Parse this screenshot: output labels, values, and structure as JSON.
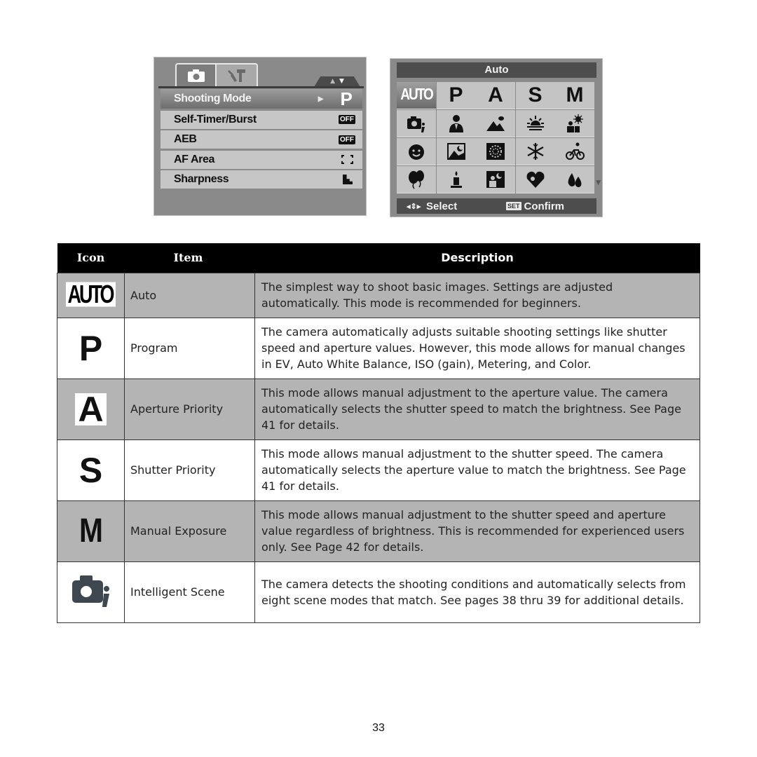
{
  "camera_menu": {
    "tabs": [
      {
        "name": "camera-tab",
        "icon": "camera-icon",
        "active": true
      },
      {
        "name": "setup-tab",
        "icon": "wrench-hammer-icon",
        "active": false
      }
    ],
    "scroll_indicator": {
      "up": "▲",
      "down": "▼"
    },
    "items": [
      {
        "label": "Shooting Mode",
        "value": "P",
        "submenu_arrow": "▶",
        "selected": true
      },
      {
        "label": "Self-Timer/Burst",
        "value": "OFF"
      },
      {
        "label": "AEB",
        "value": "OFF"
      },
      {
        "label": "AF Area",
        "value_icon": "af-area-wide-icon"
      },
      {
        "label": "Sharpness",
        "value_icon": "sharpness-normal-icon"
      }
    ]
  },
  "mode_selector": {
    "title": "Auto",
    "modes_row1": [
      "AUTO",
      "P",
      "A",
      "S",
      "M"
    ],
    "scene_icons": [
      "intelligent-scene-icon",
      "portrait-icon",
      "landscape-icon",
      "sunset-icon",
      "backlight-icon",
      "children-icon",
      "night-scene-icon",
      "fireworks-icon",
      "snow-icon",
      "sports-icon",
      "party-icon",
      "indoor-candle-icon",
      "night-portrait-icon",
      "soft-skin-icon",
      "water-icon"
    ],
    "selected_index": 0,
    "scroll_arrow": "▼",
    "footer": {
      "nav_icon": "◂⇕▸",
      "select_label": "Select",
      "set_badge": "SET",
      "confirm_label": "Confirm"
    }
  },
  "table": {
    "headers": {
      "icon": "Icon",
      "item": "Item",
      "description": "Description"
    },
    "rows": [
      {
        "icon_text": "AUTO",
        "item": "Auto",
        "description": "The simplest way to shoot basic images. Settings are adjusted automatically. This mode is recommended for beginners."
      },
      {
        "icon_text": "P",
        "item": "Program",
        "description": "The camera automatically adjusts suitable shooting settings like shutter speed and aperture values. However, this mode allows for manual changes in EV, Auto White Balance, ISO (gain), Metering, and Color."
      },
      {
        "icon_text": "A",
        "item": "Aperture Priority",
        "description": "This mode allows manual adjustment to the aperture value. The camera automatically selects the shutter speed to match the brightness. See Page 41 for details."
      },
      {
        "icon_text": "S",
        "item": "Shutter Priority",
        "description": "This mode allows manual adjustment to the shutter speed. The camera automatically selects the aperture value to match the brightness. See Page 41 for details."
      },
      {
        "icon_text": "M",
        "item": "Manual Exposure",
        "description": "This mode allows manual adjustment to the shutter speed and aperture value regardless of brightness. This is recommended for experienced users only. See Page 42 for details."
      },
      {
        "icon_text": "",
        "icon": "intelligent-scene-icon",
        "item": "Intelligent Scene",
        "description": "The camera detects the shooting conditions and automatically selects from eight scene modes that match. See pages 38 thru 39 for additional details."
      }
    ]
  },
  "page_number": "33"
}
